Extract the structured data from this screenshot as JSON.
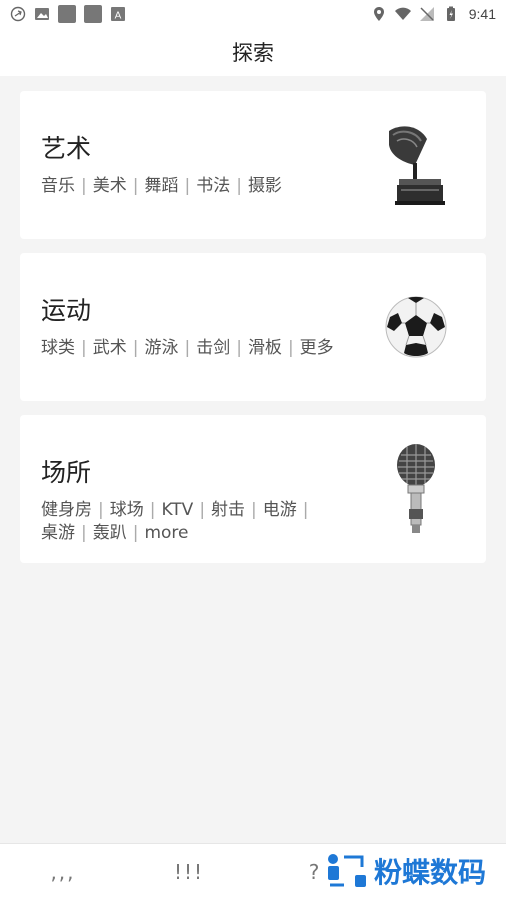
{
  "status_bar": {
    "time": "9:41",
    "icons_left": [
      "sync-icon",
      "image-icon",
      "app-icon",
      "app-icon",
      "font-icon"
    ],
    "icons_right": [
      "location-icon",
      "wifi-icon",
      "signal-off-icon",
      "battery-icon"
    ]
  },
  "header": {
    "title": "探索"
  },
  "cards": [
    {
      "title": "艺术",
      "tags": [
        "音乐",
        "美术",
        "舞蹈",
        "书法",
        "摄影"
      ],
      "image_icon": "gramophone-icon"
    },
    {
      "title": "运动",
      "tags": [
        "球类",
        "武术",
        "游泳",
        "击剑",
        "滑板",
        "更多"
      ],
      "image_icon": "soccer-ball-icon"
    },
    {
      "title": "场所",
      "tags_line1": [
        "健身房",
        "球场",
        "KTV",
        "射击",
        "电游"
      ],
      "tags_line2": [
        "桌游",
        "轰趴",
        "more"
      ],
      "image_icon": "microphone-icon"
    }
  ],
  "bottom_nav": {
    "items": [
      ",,,",
      "!!!",
      "?"
    ]
  },
  "watermark": {
    "text": "粉蝶数码"
  },
  "colors": {
    "background": "#f4f4f4",
    "card": "#ffffff",
    "watermark": "#1e78d6"
  }
}
